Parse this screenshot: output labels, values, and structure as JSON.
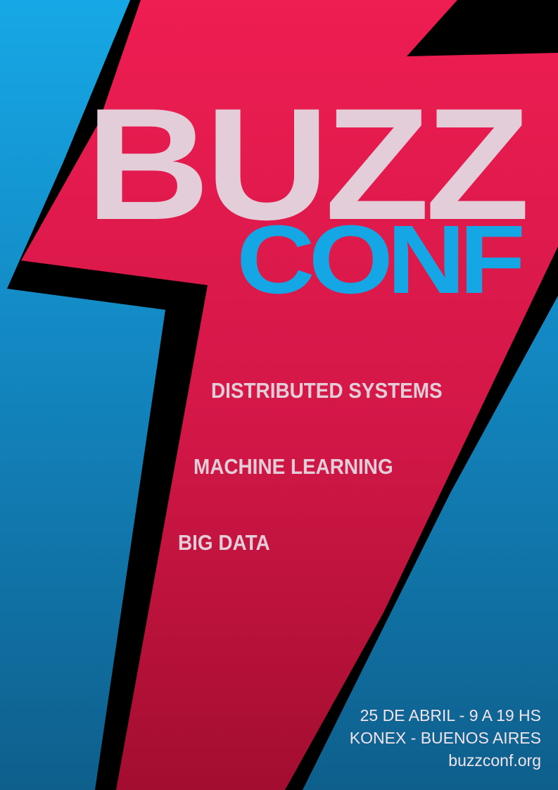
{
  "event": {
    "name_line1": "BUZZ",
    "name_line2": "CONF"
  },
  "topics": [
    "DISTRIBUTED SYSTEMS",
    "MACHINE LEARNING",
    "BIG DATA"
  ],
  "info": {
    "date_time": "25 DE ABRIL - 9 A 19 HS",
    "venue": "KONEX - BUENOS AIRES",
    "website": "buzzconf.org"
  },
  "colors": {
    "background_blue": "#16a8e6",
    "bolt_red": "#e81c4f",
    "bolt_shadow": "#000000",
    "wordmark_light": "#e3cdd9",
    "wordmark_blue": "#14a6e5"
  }
}
